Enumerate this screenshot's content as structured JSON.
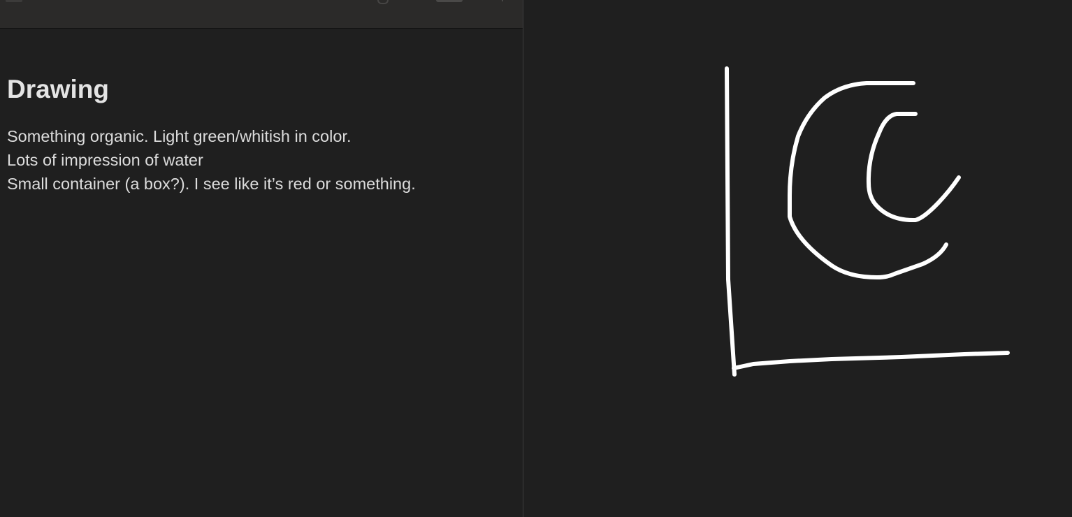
{
  "note": {
    "title": "Drawing",
    "lines": [
      "Something organic. Light green/whitish in color.",
      "Lots of impression of water",
      "Small container (a box?). I see like it’s red or something."
    ]
  },
  "colors": {
    "background": "#1f1f1f",
    "toolbar": "#2b2a29",
    "text": "#dcdcdc",
    "ink": "#ffffff"
  },
  "drawing": {
    "strokes": [
      "vertical-line",
      "horizontal-line",
      "outer-arc",
      "inner-arc"
    ]
  }
}
